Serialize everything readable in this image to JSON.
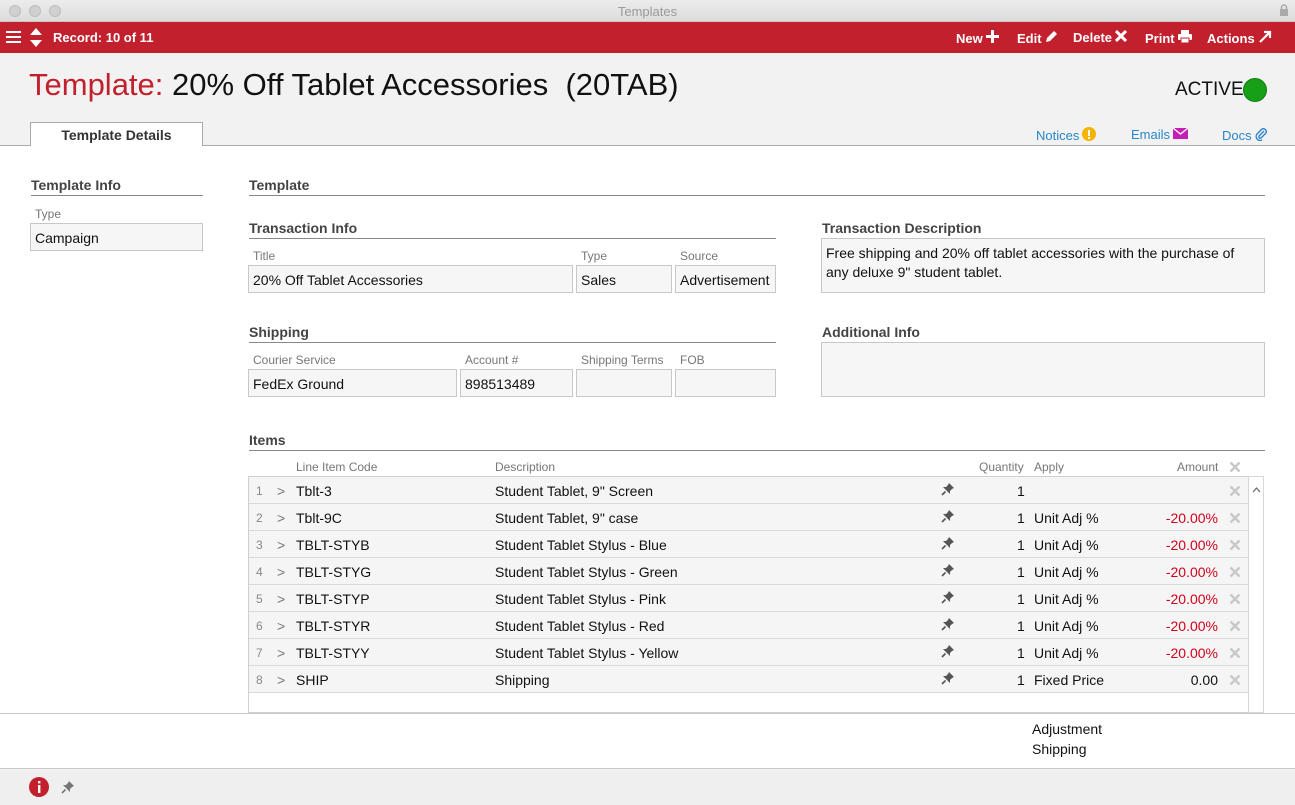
{
  "window": {
    "title": "Templates"
  },
  "toolbar": {
    "record_label": "Record: 10 of 11",
    "new_label": "New",
    "edit_label": "Edit",
    "delete_label": "Delete",
    "print_label": "Print",
    "actions_label": "Actions"
  },
  "header": {
    "label": "Template:",
    "name": "20% Off Tablet Accessories  (20TAB)",
    "status": "ACTIVE",
    "status_color": "#17a017",
    "tab": "Template Details",
    "links": {
      "notices": "Notices",
      "emails": "Emails",
      "docs": "Docs"
    }
  },
  "template_info": {
    "heading": "Template Info",
    "type_label": "Type",
    "type_value": "Campaign"
  },
  "template": {
    "heading": "Template"
  },
  "transaction_info": {
    "heading": "Transaction Info",
    "title_label": "Title",
    "title_value": "20% Off Tablet Accessories",
    "type_label": "Type",
    "type_value": "Sales",
    "source_label": "Source",
    "source_value": "Advertisement"
  },
  "transaction_description": {
    "heading": "Transaction Description",
    "value": "Free shipping and 20% off tablet accessories with the purchase of any deluxe 9\" student tablet."
  },
  "shipping": {
    "heading": "Shipping",
    "courier_label": "Courier Service",
    "courier_value": "FedEx Ground",
    "account_label": "Account #",
    "account_value": "898513489",
    "terms_label": "Shipping Terms",
    "terms_value": "",
    "fob_label": "FOB",
    "fob_value": ""
  },
  "additional_info": {
    "heading": "Additional Info",
    "value": ""
  },
  "items": {
    "heading": "Items",
    "columns": {
      "code": "Line Item Code",
      "description": "Description",
      "quantity": "Quantity",
      "apply": "Apply",
      "amount": "Amount"
    },
    "rows": [
      {
        "n": "1",
        "code": "Tblt-3",
        "description": "Student Tablet, 9\" Screen",
        "qty": "1",
        "apply": "",
        "amount": ""
      },
      {
        "n": "2",
        "code": "Tblt-9C",
        "description": "Student Tablet, 9\" case",
        "qty": "1",
        "apply": "Unit Adj %",
        "amount": "-20.00%"
      },
      {
        "n": "3",
        "code": "TBLT-STYB",
        "description": "Student Tablet Stylus - Blue",
        "qty": "1",
        "apply": "Unit Adj %",
        "amount": "-20.00%"
      },
      {
        "n": "4",
        "code": "TBLT-STYG",
        "description": "Student Tablet Stylus - Green",
        "qty": "1",
        "apply": "Unit Adj %",
        "amount": "-20.00%"
      },
      {
        "n": "5",
        "code": "TBLT-STYP",
        "description": "Student Tablet Stylus - Pink",
        "qty": "1",
        "apply": "Unit Adj %",
        "amount": "-20.00%"
      },
      {
        "n": "6",
        "code": "TBLT-STYR",
        "description": "Student Tablet Stylus - Red",
        "qty": "1",
        "apply": "Unit Adj %",
        "amount": "-20.00%"
      },
      {
        "n": "7",
        "code": "TBLT-STYY",
        "description": "Student Tablet Stylus - Yellow",
        "qty": "1",
        "apply": "Unit Adj %",
        "amount": "-20.00%"
      },
      {
        "n": "8",
        "code": "SHIP",
        "description": "Shipping",
        "qty": "1",
        "apply": "Fixed Price",
        "amount": "0.00"
      }
    ]
  },
  "footer": {
    "adjustment_label": "Adjustment",
    "shipping_label": "Shipping"
  },
  "colors": {
    "brand_red": "#c3202e",
    "link_blue": "#2a86c8",
    "negative_red": "#d0021b"
  }
}
